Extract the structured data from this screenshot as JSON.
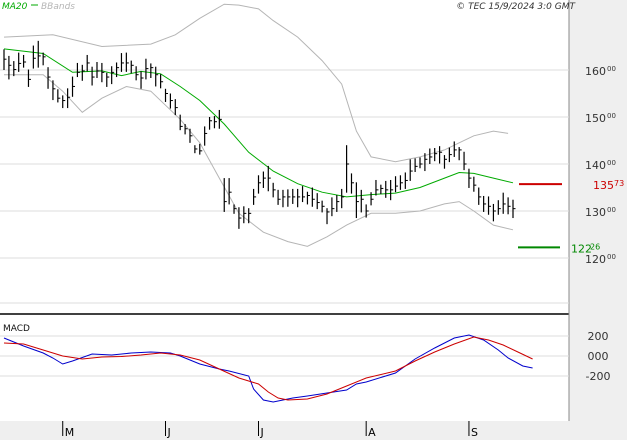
{
  "header": {
    "legend_ma": "MA20",
    "legend_bb": "BBands",
    "copyright": "© TEC 15/9/2024 3:0 GMT"
  },
  "colors": {
    "background": "#ffffff",
    "right_panel": "#efefef",
    "bottom_panel": "#efefef",
    "grid": "#dcdcdc",
    "price": "#000000",
    "ma": "#00aa00",
    "bbands": "#b5b5b5",
    "resistance": "#cc0000",
    "support": "#008800",
    "macd": "#0000cc",
    "signal": "#cc0000",
    "text": "#333333"
  },
  "chart_data": [
    {
      "type": "bar",
      "subtype": "ohlc-price",
      "title": "",
      "legend": [
        "MA20",
        "BBands"
      ],
      "x_ticks": [
        "M",
        "J",
        "J",
        "A",
        "S"
      ],
      "x_tick_index": [
        12,
        33,
        52,
        74,
        95
      ],
      "y_ticks": [
        16000,
        15000,
        14000,
        13000,
        12000
      ],
      "y_tick_labels": [
        "160",
        "150",
        "140",
        "130",
        "120"
      ],
      "y_tick_suffix": "00",
      "ylim": [
        11000,
        16800
      ],
      "grid": true,
      "levels": [
        {
          "name": "resistance",
          "value": 13573,
          "int_label": "135",
          "dec_label": "73"
        },
        {
          "name": "support",
          "value": 12226,
          "int_label": "122",
          "dec_label": "26"
        }
      ],
      "close": [
        16230,
        16100,
        16010,
        16140,
        16170,
        15800,
        16250,
        16300,
        16280,
        15850,
        15600,
        15400,
        15350,
        15420,
        15650,
        15950,
        15980,
        16150,
        15850,
        15980,
        15950,
        15850,
        15950,
        16050,
        16150,
        16150,
        16100,
        15900,
        15830,
        16030,
        16050,
        15900,
        15750,
        15500,
        15350,
        15200,
        14800,
        14750,
        14600,
        14320,
        14280,
        14650,
        14920,
        14900,
        14950,
        13200,
        13400,
        13050,
        12850,
        12950,
        12950,
        13300,
        13600,
        13700,
        13700,
        13450,
        13250,
        13300,
        13300,
        13300,
        13300,
        13300,
        13330,
        13250,
        13180,
        13100,
        12980,
        13050,
        13200,
        13300,
        14000,
        13600,
        13200,
        13250,
        13000,
        13250,
        13450,
        13480,
        13450,
        13450,
        13530,
        13600,
        13650,
        13850,
        13950,
        14000,
        14100,
        14150,
        14220,
        14250,
        14100,
        14200,
        14300,
        14300,
        14000,
        13700,
        13550,
        13300,
        13150,
        13100,
        13000,
        13050,
        13150,
        13100,
        13050
      ],
      "ranges": [
        [
          16000,
          16440
        ],
        [
          15800,
          16300
        ],
        [
          15870,
          16190
        ],
        [
          15960,
          16370
        ],
        [
          16050,
          16320
        ],
        [
          15640,
          16010
        ],
        [
          16030,
          16520
        ],
        [
          16050,
          16620
        ],
        [
          16100,
          16370
        ],
        [
          15600,
          16060
        ],
        [
          15360,
          15780
        ],
        [
          15310,
          15590
        ],
        [
          15190,
          15460
        ],
        [
          15190,
          15610
        ],
        [
          15430,
          15860
        ],
        [
          15850,
          16150
        ],
        [
          15770,
          16110
        ],
        [
          15970,
          16320
        ],
        [
          15670,
          16070
        ],
        [
          15830,
          16170
        ],
        [
          15740,
          16150
        ],
        [
          15640,
          15940
        ],
        [
          15700,
          16080
        ],
        [
          15850,
          16160
        ],
        [
          15960,
          16360
        ],
        [
          15960,
          16370
        ],
        [
          15930,
          16200
        ],
        [
          15780,
          16080
        ],
        [
          15600,
          15970
        ],
        [
          15800,
          16240
        ],
        [
          15830,
          16140
        ],
        [
          15650,
          16070
        ],
        [
          15610,
          15910
        ],
        [
          15320,
          15600
        ],
        [
          15180,
          15500
        ],
        [
          15040,
          15380
        ],
        [
          14720,
          15050
        ],
        [
          14630,
          14850
        ],
        [
          14450,
          14750
        ],
        [
          14230,
          14400
        ],
        [
          14200,
          14430
        ],
        [
          14390,
          14800
        ],
        [
          14730,
          15000
        ],
        [
          14760,
          15020
        ],
        [
          14750,
          15150
        ],
        [
          12980,
          13700
        ],
        [
          13140,
          13700
        ],
        [
          12940,
          13140
        ],
        [
          12620,
          13080
        ],
        [
          12740,
          13100
        ],
        [
          12740,
          13060
        ],
        [
          13130,
          13470
        ],
        [
          13370,
          13760
        ],
        [
          13490,
          13840
        ],
        [
          13420,
          13960
        ],
        [
          13290,
          13600
        ],
        [
          13130,
          13450
        ],
        [
          13080,
          13450
        ],
        [
          13090,
          13460
        ],
        [
          13150,
          13470
        ],
        [
          13080,
          13470
        ],
        [
          13190,
          13530
        ],
        [
          13140,
          13410
        ],
        [
          13090,
          13500
        ],
        [
          13040,
          13380
        ],
        [
          12970,
          13220
        ],
        [
          12720,
          13060
        ],
        [
          12890,
          13290
        ],
        [
          12980,
          13340
        ],
        [
          13060,
          13470
        ],
        [
          13390,
          14400
        ],
        [
          13370,
          13800
        ],
        [
          12850,
          13610
        ],
        [
          12970,
          13450
        ],
        [
          12860,
          13140
        ],
        [
          13120,
          13400
        ],
        [
          13330,
          13660
        ],
        [
          13360,
          13560
        ],
        [
          13280,
          13640
        ],
        [
          13230,
          13660
        ],
        [
          13400,
          13740
        ],
        [
          13450,
          13760
        ],
        [
          13470,
          13820
        ],
        [
          13640,
          14100
        ],
        [
          13830,
          14120
        ],
        [
          13910,
          14140
        ],
        [
          13850,
          14230
        ],
        [
          14000,
          14330
        ],
        [
          14060,
          14340
        ],
        [
          14010,
          14380
        ],
        [
          13900,
          14190
        ],
        [
          14040,
          14350
        ],
        [
          14150,
          14480
        ],
        [
          14080,
          14360
        ],
        [
          13870,
          14260
        ],
        [
          13490,
          13900
        ],
        [
          13410,
          13730
        ],
        [
          13130,
          13500
        ],
        [
          12980,
          13320
        ],
        [
          12920,
          13310
        ],
        [
          12780,
          13150
        ],
        [
          12920,
          13230
        ],
        [
          12940,
          13390
        ],
        [
          12930,
          13290
        ],
        [
          12850,
          13240
        ]
      ],
      "ma20": [
        [
          0,
          16450
        ],
        [
          8,
          16350
        ],
        [
          14,
          15950
        ],
        [
          20,
          15980
        ],
        [
          24,
          15880
        ],
        [
          28,
          15970
        ],
        [
          32,
          15920
        ],
        [
          36,
          15650
        ],
        [
          40,
          15350
        ],
        [
          45,
          14850
        ],
        [
          50,
          14250
        ],
        [
          55,
          13850
        ],
        [
          60,
          13580
        ],
        [
          65,
          13400
        ],
        [
          70,
          13300
        ],
        [
          75,
          13350
        ],
        [
          80,
          13380
        ],
        [
          85,
          13500
        ],
        [
          90,
          13700
        ],
        [
          93,
          13820
        ],
        [
          96,
          13800
        ],
        [
          100,
          13700
        ],
        [
          104,
          13600
        ]
      ],
      "bb_upper": [
        [
          0,
          16700
        ],
        [
          10,
          16750
        ],
        [
          20,
          16500
        ],
        [
          30,
          16550
        ],
        [
          35,
          16750
        ],
        [
          40,
          17100
        ],
        [
          45,
          17400
        ],
        [
          48,
          17380
        ],
        [
          52,
          17300
        ],
        [
          55,
          17050
        ],
        [
          60,
          16700
        ],
        [
          65,
          16200
        ],
        [
          69,
          15700
        ],
        [
          72,
          14700
        ],
        [
          75,
          14150
        ],
        [
          80,
          14050
        ],
        [
          85,
          14150
        ],
        [
          90,
          14300
        ],
        [
          93,
          14450
        ],
        [
          96,
          14600
        ],
        [
          100,
          14700
        ],
        [
          103,
          14650
        ]
      ],
      "bb_lower": [
        [
          0,
          15900
        ],
        [
          8,
          15900
        ],
        [
          12,
          15550
        ],
        [
          16,
          15100
        ],
        [
          20,
          15400
        ],
        [
          25,
          15650
        ],
        [
          30,
          15550
        ],
        [
          36,
          14950
        ],
        [
          40,
          14450
        ],
        [
          44,
          13700
        ],
        [
          48,
          12950
        ],
        [
          53,
          12550
        ],
        [
          58,
          12350
        ],
        [
          62,
          12250
        ],
        [
          66,
          12450
        ],
        [
          70,
          12700
        ],
        [
          75,
          12950
        ],
        [
          80,
          12950
        ],
        [
          85,
          13000
        ],
        [
          90,
          13150
        ],
        [
          93,
          13200
        ],
        [
          96,
          13000
        ],
        [
          100,
          12700
        ],
        [
          104,
          12600
        ]
      ]
    },
    {
      "type": "line",
      "title": "MACD",
      "y_ticks": [
        200,
        0,
        -200
      ],
      "y_tick_labels": [
        "200",
        "000",
        "-200"
      ],
      "ylim": [
        -480,
        260
      ],
      "grid": true,
      "series": [
        {
          "name": "MACD",
          "points": [
            [
              0,
              180
            ],
            [
              4,
              100
            ],
            [
              8,
              30
            ],
            [
              10,
              -20
            ],
            [
              12,
              -80
            ],
            [
              14,
              -50
            ],
            [
              18,
              20
            ],
            [
              22,
              10
            ],
            [
              26,
              30
            ],
            [
              30,
              40
            ],
            [
              34,
              30
            ],
            [
              36,
              0
            ],
            [
              40,
              -80
            ],
            [
              44,
              -130
            ],
            [
              46,
              -150
            ],
            [
              50,
              -200
            ],
            [
              51,
              -330
            ],
            [
              53,
              -440
            ],
            [
              55,
              -460
            ],
            [
              57,
              -440
            ],
            [
              59,
              -420
            ],
            [
              62,
              -400
            ],
            [
              66,
              -370
            ],
            [
              70,
              -340
            ],
            [
              72,
              -280
            ],
            [
              74,
              -260
            ],
            [
              80,
              -170
            ],
            [
              84,
              -30
            ],
            [
              88,
              80
            ],
            [
              92,
              180
            ],
            [
              95,
              210
            ],
            [
              98,
              160
            ],
            [
              101,
              60
            ],
            [
              103,
              -20
            ],
            [
              106,
              -100
            ],
            [
              108,
              -120
            ]
          ]
        },
        {
          "name": "Signal",
          "points": [
            [
              0,
              130
            ],
            [
              4,
              120
            ],
            [
              8,
              60
            ],
            [
              12,
              0
            ],
            [
              16,
              -30
            ],
            [
              20,
              -10
            ],
            [
              24,
              -5
            ],
            [
              28,
              10
            ],
            [
              32,
              30
            ],
            [
              36,
              10
            ],
            [
              40,
              -40
            ],
            [
              44,
              -130
            ],
            [
              48,
              -220
            ],
            [
              50,
              -250
            ],
            [
              52,
              -280
            ],
            [
              54,
              -360
            ],
            [
              56,
              -420
            ],
            [
              58,
              -440
            ],
            [
              62,
              -430
            ],
            [
              66,
              -380
            ],
            [
              70,
              -300
            ],
            [
              74,
              -220
            ],
            [
              80,
              -150
            ],
            [
              84,
              -50
            ],
            [
              88,
              40
            ],
            [
              92,
              120
            ],
            [
              96,
              190
            ],
            [
              99,
              160
            ],
            [
              102,
              110
            ],
            [
              105,
              40
            ],
            [
              108,
              -30
            ]
          ]
        }
      ]
    }
  ]
}
